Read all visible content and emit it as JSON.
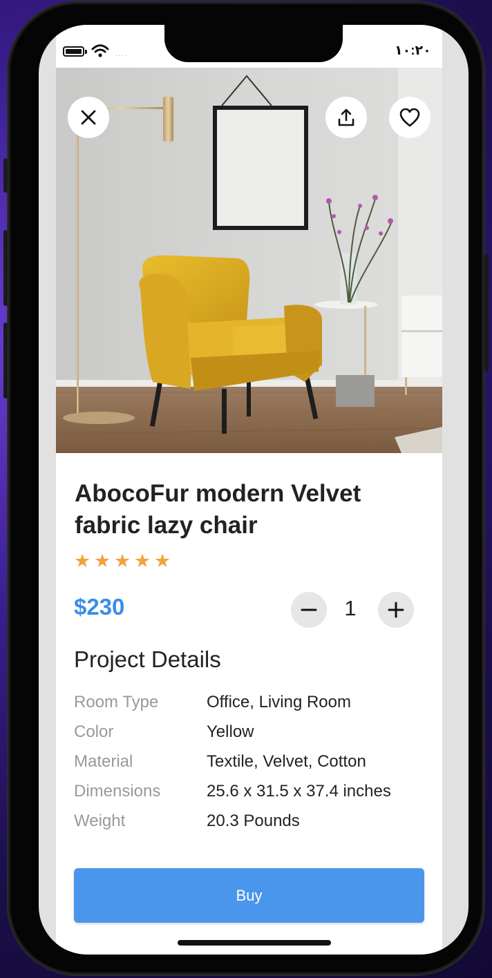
{
  "status_bar": {
    "time": "١٠:٢٠",
    "signal_dots": "....",
    "icons": [
      "battery-icon",
      "wifi-icon"
    ]
  },
  "hero_actions": [
    "close-icon",
    "share-icon",
    "heart-icon"
  ],
  "product": {
    "title": "AbocoFur modern Velvet fabric lazy chair",
    "rating": 5,
    "rating_max": 5,
    "price": "$230",
    "quantity": "1"
  },
  "details": {
    "heading": "Project Details",
    "rows": [
      {
        "label": "Room Type",
        "value": "Office, Living Room"
      },
      {
        "label": "Color",
        "value": "Yellow"
      },
      {
        "label": "Material",
        "value": "Textile, Velvet, Cotton"
      },
      {
        "label": "Dimensions",
        "value": "25.6 x 31.5 x 37.4 inches"
      },
      {
        "label": "Weight",
        "value": "20.3 Pounds"
      }
    ]
  },
  "buy_label": "Buy",
  "colors": {
    "accent": "#4a96ec",
    "price": "#3b8de8",
    "star": "#f2a33a"
  }
}
